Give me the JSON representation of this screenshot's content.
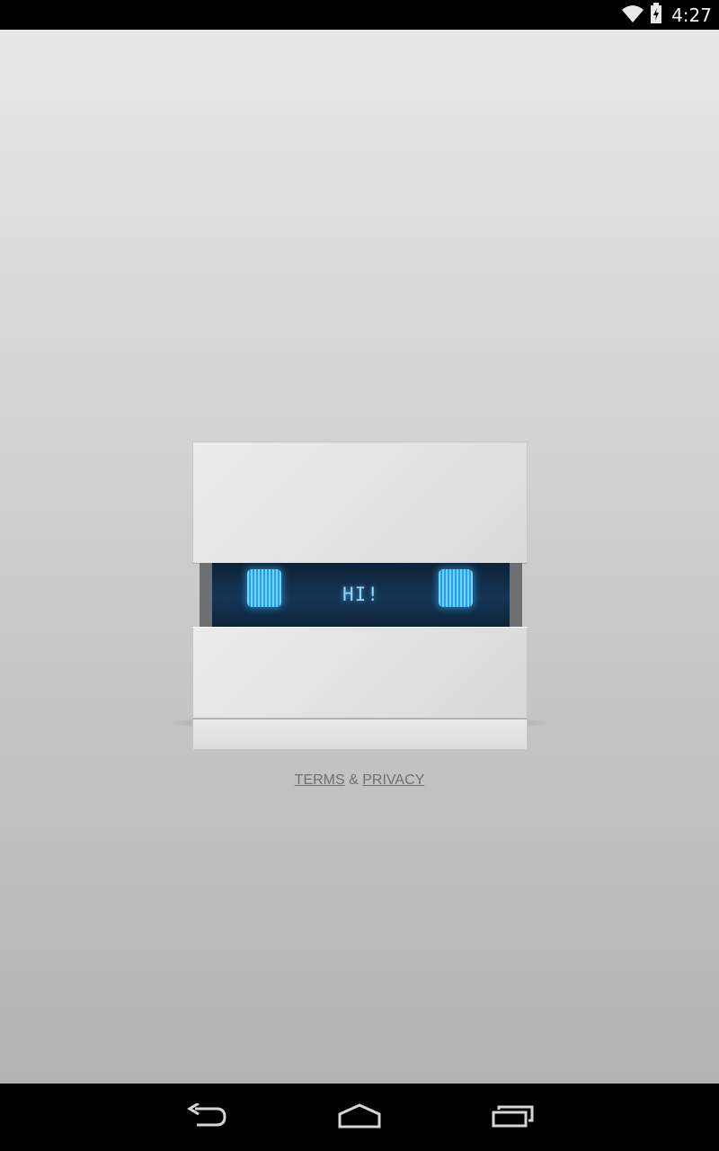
{
  "status_bar": {
    "time": "4:27",
    "icons": [
      "wifi-icon",
      "battery-icon"
    ]
  },
  "robot": {
    "visor_text": "HI!",
    "eye_color": "#4fc3f7",
    "visor_color": "#13304d"
  },
  "legal": {
    "terms_label": "TERMS",
    "separator": "&",
    "privacy_label": "PRIVACY"
  },
  "nav_bar": {
    "buttons": [
      "back-icon",
      "home-icon",
      "recent-apps-icon"
    ]
  }
}
